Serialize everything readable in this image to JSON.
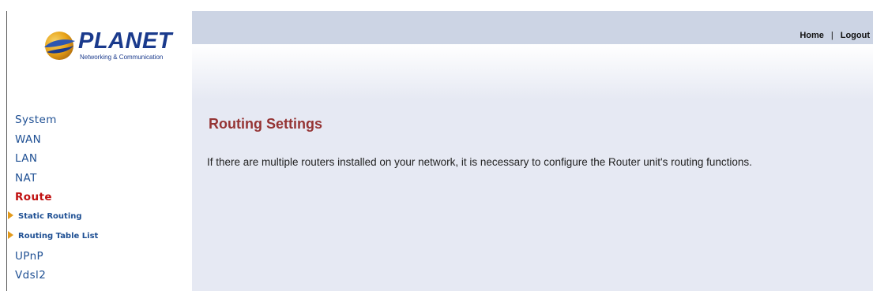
{
  "brand": {
    "name": "PLANET",
    "tagline": "Networking & Communication",
    "logo_colors": {
      "blue": "#1a3a8c",
      "gold": "#e8a317"
    }
  },
  "header": {
    "home_label": "Home",
    "separator": "|",
    "logout_label": "Logout"
  },
  "sidebar": {
    "items": [
      {
        "label": "System"
      },
      {
        "label": "WAN"
      },
      {
        "label": "LAN"
      },
      {
        "label": "NAT"
      },
      {
        "label": "Route",
        "active": true
      },
      {
        "label": "Static Routing"
      },
      {
        "label": "Routing Table List"
      },
      {
        "label": "UPnP"
      },
      {
        "label": "Vdsl2"
      }
    ]
  },
  "main": {
    "title": "Routing Settings",
    "description": "If there are multiple routers installed on your network, it is necessary to configure the Router unit's routing functions."
  },
  "colors": {
    "nav_text": "#1e4f93",
    "nav_active": "#c01010",
    "title": "#953434",
    "content_bg": "#e6e9f3",
    "topbar_bg": "#ccd4e4"
  }
}
